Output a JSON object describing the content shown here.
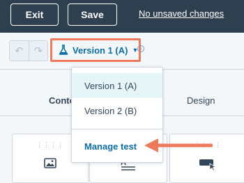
{
  "header": {
    "exit_label": "Exit",
    "save_label": "Save",
    "unsaved_label": "No unsaved changes"
  },
  "toolbar": {
    "version_label": "Version 1 (A)",
    "undo_icon": "undo-icon",
    "redo_icon": "redo-icon"
  },
  "tabs": [
    {
      "label": "Conte"
    },
    {
      "label": "Design"
    }
  ],
  "dropdown": {
    "items": [
      {
        "label": "Version 1 (A)",
        "selected": true
      },
      {
        "label": "Version 2 (B)",
        "selected": false
      }
    ],
    "manage_label": "Manage test"
  },
  "modules": [
    {
      "icon": "image-icon"
    },
    {
      "icon": "text-icon"
    },
    {
      "icon": "button-cursor-icon"
    }
  ],
  "colors": {
    "header_bg": "#2e3f50",
    "accent_link": "#0b6fa6",
    "highlight_outline": "#ef7a5b",
    "selected_item_bg": "#e5f5f8"
  }
}
